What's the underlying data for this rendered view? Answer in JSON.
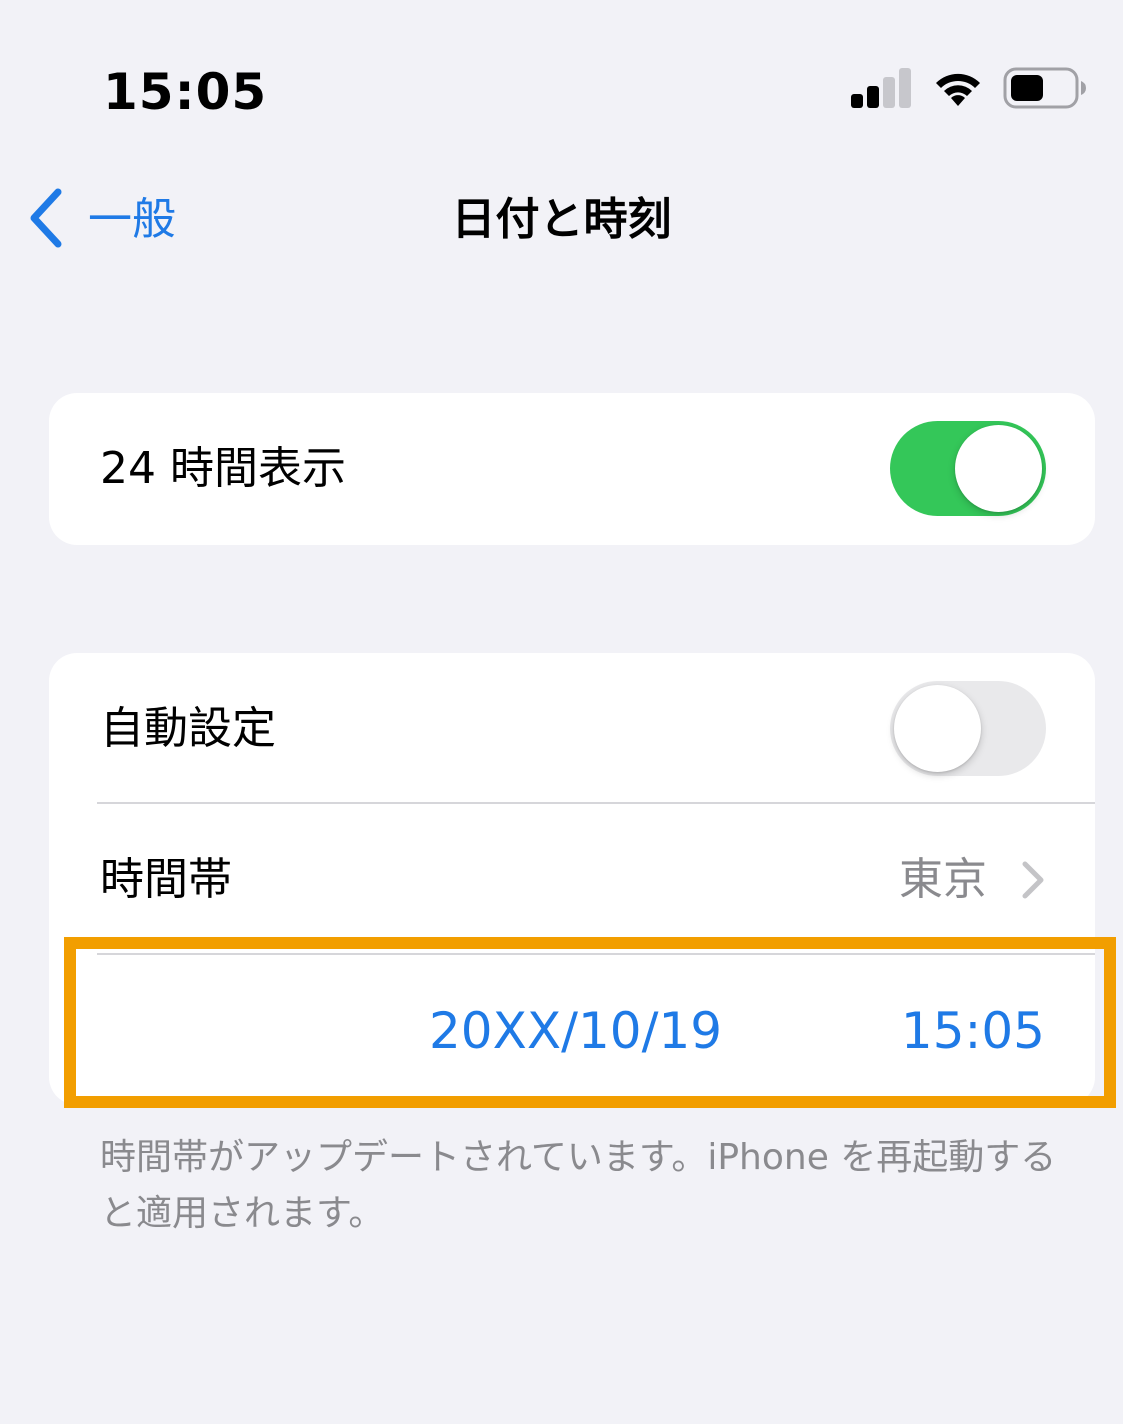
{
  "status_bar": {
    "time": "15:05",
    "icons": [
      "cellular-signal-icon",
      "wifi-icon",
      "battery-icon"
    ]
  },
  "nav": {
    "back_label": "一般",
    "title": "日付と時刻"
  },
  "group1": {
    "rows": [
      {
        "label": "24 時間表示",
        "toggle": "on"
      }
    ]
  },
  "group2": {
    "auto_set": {
      "label": "自動設定",
      "toggle": "off"
    },
    "time_zone": {
      "label": "時間帯",
      "value": "東京"
    },
    "datetime": {
      "date": "20XX/10/19",
      "time": "15:05"
    }
  },
  "footer": {
    "note": "時間帯がアップデートされています。iPhone を再起動すると適用されます。"
  },
  "colors": {
    "accent": "#1f7ae6",
    "toggle_on": "#34c759",
    "toggle_off": "#e9e9eb",
    "highlight": "#f29e00",
    "background": "#f2f2f7",
    "secondary_text": "#8a8a8e"
  }
}
